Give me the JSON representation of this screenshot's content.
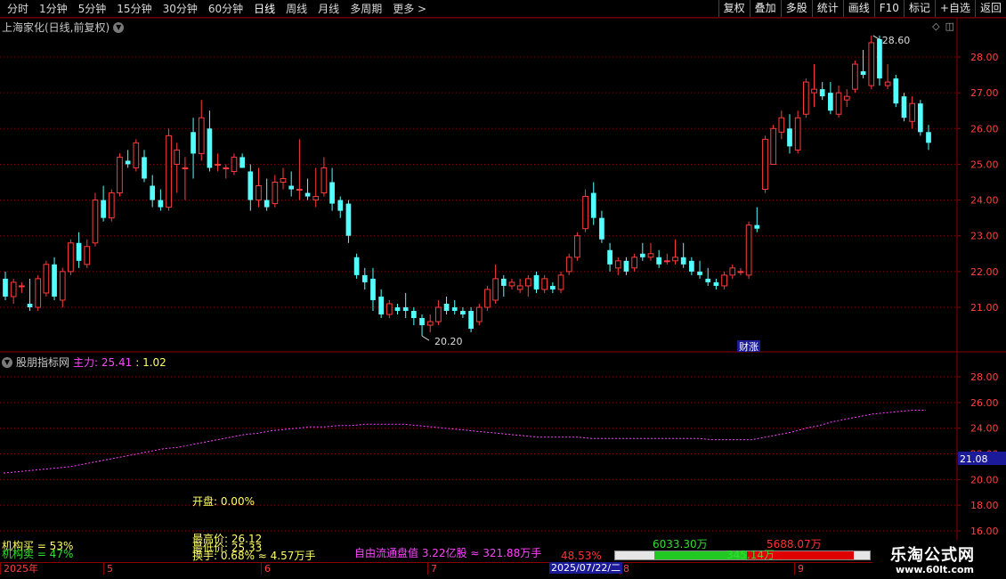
{
  "toolbar": {
    "periods": [
      "分时",
      "1分钟",
      "5分钟",
      "15分钟",
      "30分钟",
      "60分钟",
      "日线",
      "周线",
      "月线",
      "多周期",
      "更多 >"
    ],
    "active_period": "日线",
    "actions": [
      "复权",
      "叠加",
      "多股",
      "统计",
      "画线",
      "F10",
      "标记",
      "+自选",
      "返回"
    ]
  },
  "main_chart": {
    "title": "上海家化(日线,前复权)",
    "high_label": "28.60",
    "low_label": "20.20",
    "event_badge": "财涨",
    "y_ticks": [
      "28.00",
      "27.00",
      "26.00",
      "25.00",
      "24.00",
      "23.00",
      "22.00",
      "21.00"
    ]
  },
  "sub_chart": {
    "title": "股朋指标网",
    "main_label": "主力: 25.41",
    "ratio": ": 1.02",
    "y_ticks": [
      "28.00",
      "26.00",
      "24.00",
      "22.00",
      "20.00",
      "18.00",
      "16.00"
    ],
    "current_value": "21.08"
  },
  "info": {
    "open_label": "开盘: 0.00%",
    "inst_buy": "机构买 = 53%",
    "inst_sell": "机构卖 = 47%",
    "high_price": "最高价: 26.12",
    "low_price": "最低价: 25.33",
    "turnover": "换手: 0.68% ≈ 4.57万手",
    "float_cap": "自由流通盘值 3.22亿股 ≈ 321.88万手",
    "pct": "48.53%",
    "buy_amount": "6033.30万",
    "sell_amount": "5688.07万",
    "mid_amount": "345.14万"
  },
  "date_axis": {
    "labels": [
      "2025年",
      "5",
      "6",
      "7",
      "8",
      "9"
    ],
    "cursor_date": "2025/07/22/二"
  },
  "logo": {
    "name": "乐淘公式网",
    "url": "www.60lt.com"
  },
  "colors": {
    "up": "#ff3c3c",
    "down": "#54ffff",
    "line": "#ff44ff",
    "grid": "#8b0000"
  },
  "chart_data": {
    "type": "candlestick",
    "ylim": [
      20.0,
      28.8
    ],
    "candles": [
      [
        21.8,
        22.0,
        21.2,
        21.3
      ],
      [
        21.3,
        21.8,
        21.1,
        21.7
      ],
      [
        21.6,
        21.7,
        21.4,
        21.6
      ],
      [
        21.1,
        21.8,
        20.9,
        21.0
      ],
      [
        21.0,
        21.9,
        20.9,
        21.8
      ],
      [
        21.4,
        22.3,
        21.3,
        22.2
      ],
      [
        22.2,
        22.4,
        21.2,
        21.3
      ],
      [
        21.2,
        22.1,
        21.0,
        22.0
      ],
      [
        22.0,
        22.9,
        21.9,
        22.8
      ],
      [
        22.8,
        23.1,
        22.1,
        22.3
      ],
      [
        22.2,
        22.9,
        22.1,
        22.7
      ],
      [
        22.8,
        24.2,
        22.7,
        24.0
      ],
      [
        24.0,
        24.4,
        23.4,
        23.5
      ],
      [
        23.5,
        24.3,
        23.4,
        24.2
      ],
      [
        24.2,
        25.3,
        24.1,
        25.2
      ],
      [
        25.1,
        25.4,
        24.9,
        25.0
      ],
      [
        24.9,
        25.7,
        24.8,
        25.6
      ],
      [
        25.2,
        25.4,
        24.5,
        24.6
      ],
      [
        24.4,
        24.7,
        23.8,
        24.0
      ],
      [
        24.0,
        24.3,
        23.7,
        23.8
      ],
      [
        23.8,
        26.0,
        23.7,
        25.8
      ],
      [
        25.0,
        25.6,
        24.2,
        25.4
      ],
      [
        24.9,
        25.2,
        24.0,
        24.9
      ],
      [
        25.9,
        26.3,
        24.6,
        25.3
      ],
      [
        25.3,
        26.8,
        25.1,
        26.3
      ],
      [
        26.0,
        26.5,
        24.8,
        24.9
      ],
      [
        25.0,
        25.3,
        24.8,
        25.0
      ],
      [
        24.9,
        25.0,
        24.6,
        24.9
      ],
      [
        24.8,
        25.3,
        24.7,
        25.2
      ],
      [
        25.2,
        25.3,
        24.9,
        24.9
      ],
      [
        24.8,
        25.0,
        23.7,
        24.0
      ],
      [
        24.0,
        24.9,
        23.8,
        24.4
      ],
      [
        24.0,
        24.6,
        23.7,
        23.8
      ],
      [
        23.9,
        24.7,
        23.8,
        24.5
      ],
      [
        24.5,
        24.9,
        24.3,
        24.6
      ],
      [
        24.4,
        24.8,
        24.1,
        24.3
      ],
      [
        24.3,
        25.7,
        24.0,
        24.3
      ],
      [
        24.2,
        24.6,
        24.0,
        24.1
      ],
      [
        24.0,
        24.9,
        23.8,
        24.1
      ],
      [
        24.2,
        25.2,
        24.1,
        24.9
      ],
      [
        24.5,
        24.9,
        23.7,
        23.9
      ],
      [
        24.0,
        24.1,
        23.5,
        23.7
      ],
      [
        23.9,
        24.0,
        22.8,
        23.0
      ],
      [
        22.4,
        22.5,
        21.8,
        21.9
      ],
      [
        21.9,
        22.1,
        21.5,
        21.7
      ],
      [
        21.8,
        22.1,
        20.9,
        21.2
      ],
      [
        21.3,
        21.5,
        20.7,
        20.8
      ],
      [
        20.8,
        21.2,
        20.7,
        21.1
      ],
      [
        21.0,
        21.1,
        20.8,
        20.9
      ],
      [
        21.0,
        21.4,
        20.7,
        20.9
      ],
      [
        20.9,
        21.0,
        20.5,
        20.7
      ],
      [
        20.7,
        20.8,
        20.2,
        20.5
      ],
      [
        20.5,
        20.8,
        20.3,
        20.6
      ],
      [
        20.6,
        21.2,
        20.5,
        21.0
      ],
      [
        21.1,
        21.3,
        20.8,
        20.9
      ],
      [
        21.0,
        21.2,
        20.8,
        20.9
      ],
      [
        20.9,
        21.0,
        20.7,
        20.8
      ],
      [
        20.9,
        21.0,
        20.3,
        20.4
      ],
      [
        20.6,
        21.1,
        20.5,
        21.0
      ],
      [
        21.0,
        21.6,
        20.9,
        21.5
      ],
      [
        21.2,
        22.2,
        21.1,
        21.8
      ],
      [
        21.8,
        21.9,
        21.3,
        21.6
      ],
      [
        21.6,
        21.8,
        21.5,
        21.7
      ],
      [
        21.5,
        21.8,
        21.4,
        21.6
      ],
      [
        21.6,
        21.9,
        21.3,
        21.8
      ],
      [
        21.9,
        22.0,
        21.4,
        21.5
      ],
      [
        21.5,
        21.9,
        21.4,
        21.8
      ],
      [
        21.6,
        21.7,
        21.4,
        21.5
      ],
      [
        21.5,
        22.0,
        21.4,
        21.9
      ],
      [
        22.0,
        22.5,
        21.9,
        22.4
      ],
      [
        22.4,
        23.1,
        22.3,
        23.0
      ],
      [
        23.2,
        24.3,
        23.1,
        24.1
      ],
      [
        24.2,
        24.5,
        23.3,
        23.5
      ],
      [
        23.5,
        23.7,
        22.8,
        22.9
      ],
      [
        22.6,
        22.8,
        22.0,
        22.2
      ],
      [
        22.1,
        22.4,
        21.9,
        22.3
      ],
      [
        22.3,
        22.4,
        21.9,
        22.0
      ],
      [
        22.1,
        22.5,
        22.0,
        22.4
      ],
      [
        22.5,
        22.8,
        22.3,
        22.4
      ],
      [
        22.4,
        22.8,
        22.3,
        22.5
      ],
      [
        22.4,
        22.6,
        22.1,
        22.2
      ],
      [
        22.3,
        22.5,
        22.2,
        22.3
      ],
      [
        22.3,
        22.9,
        22.2,
        22.4
      ],
      [
        22.4,
        22.8,
        22.1,
        22.2
      ],
      [
        22.3,
        22.4,
        21.9,
        22.0
      ],
      [
        22.0,
        22.3,
        21.8,
        21.9
      ],
      [
        21.8,
        22.1,
        21.6,
        21.7
      ],
      [
        21.7,
        21.8,
        21.5,
        21.6
      ],
      [
        21.6,
        22.0,
        21.5,
        21.9
      ],
      [
        21.9,
        22.2,
        21.8,
        22.1
      ],
      [
        22.0,
        22.1,
        21.9,
        22.0
      ],
      [
        21.9,
        23.4,
        21.8,
        23.3
      ],
      [
        23.3,
        23.8,
        23.1,
        23.2
      ],
      [
        24.3,
        25.8,
        24.2,
        25.7
      ],
      [
        25.0,
        26.1,
        25.0,
        26.0
      ],
      [
        25.9,
        26.5,
        25.7,
        26.3
      ],
      [
        26.0,
        26.4,
        25.3,
        25.5
      ],
      [
        25.4,
        26.5,
        25.3,
        26.3
      ],
      [
        26.4,
        27.4,
        26.3,
        27.3
      ],
      [
        27.0,
        27.8,
        26.6,
        27.1
      ],
      [
        27.1,
        27.3,
        26.8,
        26.9
      ],
      [
        27.0,
        27.3,
        26.4,
        26.5
      ],
      [
        26.4,
        27.2,
        26.3,
        27.0
      ],
      [
        26.8,
        27.1,
        26.6,
        26.9
      ],
      [
        27.1,
        27.9,
        27.0,
        27.8
      ],
      [
        27.6,
        28.2,
        27.4,
        27.5
      ],
      [
        27.2,
        28.6,
        27.1,
        28.4
      ],
      [
        28.5,
        28.6,
        27.2,
        27.4
      ],
      [
        27.2,
        27.8,
        27.1,
        27.3
      ],
      [
        27.4,
        27.5,
        26.6,
        26.7
      ],
      [
        26.9,
        27.0,
        26.2,
        26.3
      ],
      [
        26.2,
        26.9,
        26.0,
        26.7
      ],
      [
        26.7,
        26.8,
        25.8,
        25.9
      ],
      [
        25.9,
        26.1,
        25.4,
        25.6
      ]
    ],
    "indicator_line": [
      20.5,
      20.6,
      20.7,
      20.8,
      20.9,
      21.0,
      21.2,
      21.4,
      21.6,
      21.8,
      22.0,
      22.2,
      22.4,
      22.5,
      22.7,
      22.9,
      23.1,
      23.3,
      23.5,
      23.6,
      23.8,
      23.9,
      24.0,
      24.1,
      24.1,
      24.2,
      24.2,
      24.3,
      24.3,
      24.3,
      24.3,
      24.2,
      24.1,
      24.0,
      23.9,
      23.8,
      23.7,
      23.6,
      23.5,
      23.4,
      23.3,
      23.3,
      23.3,
      23.3,
      23.2,
      23.2,
      23.2,
      23.2,
      23.2,
      23.2,
      23.2,
      23.2,
      23.2,
      23.1,
      23.1,
      23.1,
      23.1,
      23.3,
      23.5,
      23.7,
      24.0,
      24.2,
      24.5,
      24.7,
      24.9,
      25.1,
      25.2,
      25.3,
      25.4,
      25.4
    ]
  }
}
